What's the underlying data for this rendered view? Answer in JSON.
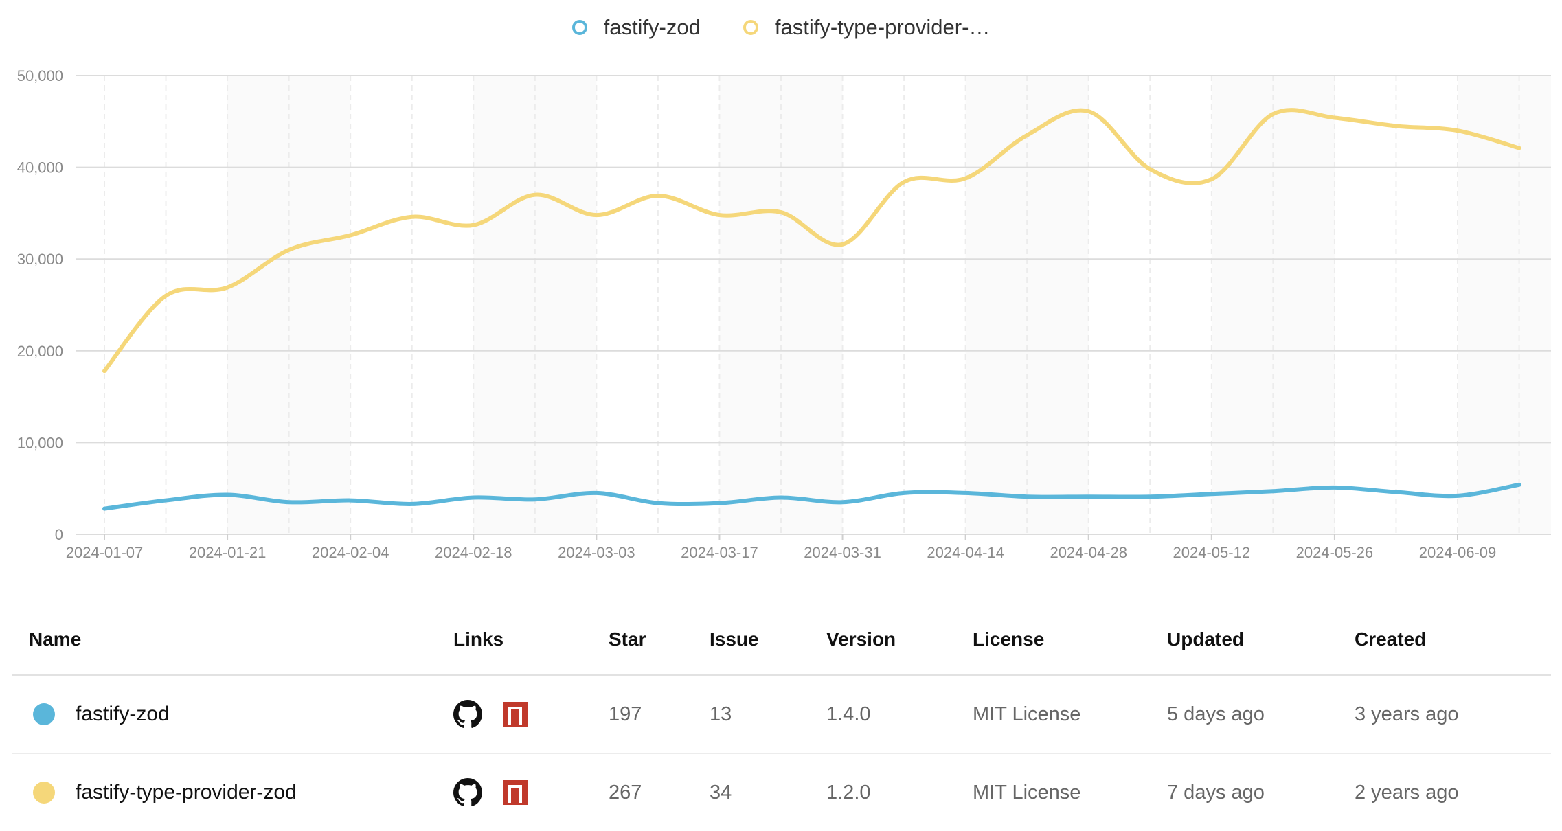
{
  "colors": {
    "zod": "#5ab6da",
    "provider": "#f5d77a",
    "grid": "#e3e3e3",
    "axis_text": "#888888"
  },
  "legend": [
    {
      "name": "fastify-zod",
      "color": "#5ab6da"
    },
    {
      "name": "fastify-type-provider-…",
      "color": "#f5d77a"
    }
  ],
  "chart_data": {
    "type": "line",
    "x_tick_labels": [
      "2024-01-07",
      "2024-01-21",
      "2024-02-04",
      "2024-02-18",
      "2024-03-03",
      "2024-03-17",
      "2024-03-31",
      "2024-04-14",
      "2024-04-28",
      "2024-05-12",
      "2024-05-26",
      "2024-06-09"
    ],
    "x": [
      "2024-01-07",
      "2024-01-14",
      "2024-01-21",
      "2024-01-28",
      "2024-02-04",
      "2024-02-11",
      "2024-02-18",
      "2024-02-25",
      "2024-03-03",
      "2024-03-10",
      "2024-03-17",
      "2024-03-24",
      "2024-03-31",
      "2024-04-07",
      "2024-04-14",
      "2024-04-21",
      "2024-04-28",
      "2024-05-05",
      "2024-05-12",
      "2024-05-19",
      "2024-05-26",
      "2024-06-02",
      "2024-06-09",
      "2024-06-16"
    ],
    "series": [
      {
        "name": "fastify-zod",
        "color": "#5ab6da",
        "values": [
          2800,
          3700,
          4300,
          3500,
          3700,
          3300,
          4000,
          3800,
          4500,
          3400,
          3400,
          4000,
          3500,
          4500,
          4500,
          4100,
          4100,
          4100,
          4400,
          4700,
          5100,
          4600,
          4200,
          5400
        ]
      },
      {
        "name": "fastify-type-provider-zod",
        "color": "#f5d77a",
        "values": [
          17800,
          26000,
          26900,
          31000,
          32600,
          34600,
          33700,
          37000,
          34800,
          36900,
          34800,
          35100,
          31600,
          38400,
          38800,
          43500,
          46100,
          39800,
          38700,
          45800,
          45400,
          44500,
          44000,
          42100
        ]
      }
    ],
    "y_ticks": [
      0,
      10000,
      20000,
      30000,
      40000,
      50000
    ],
    "y_tick_labels": [
      "0",
      "10,000",
      "20,000",
      "30,000",
      "40,000",
      "50,000"
    ],
    "ylim": [
      0,
      50000
    ],
    "grid": true,
    "legend_position": "top-center"
  },
  "table": {
    "headers": [
      "Name",
      "Links",
      "Star",
      "Issue",
      "Version",
      "License",
      "Updated",
      "Created"
    ],
    "rows": [
      {
        "name": "fastify-zod",
        "color": "#5ab6da",
        "links": [
          "github-icon",
          "npm-icon"
        ],
        "star": "197",
        "issue": "13",
        "version": "1.4.0",
        "license": "MIT License",
        "updated": "5 days ago",
        "created": "3 years ago"
      },
      {
        "name": "fastify-type-provider-zod",
        "color": "#f5d77a",
        "links": [
          "github-icon",
          "npm-icon"
        ],
        "star": "267",
        "issue": "34",
        "version": "1.2.0",
        "license": "MIT License",
        "updated": "7 days ago",
        "created": "2 years ago"
      }
    ]
  }
}
